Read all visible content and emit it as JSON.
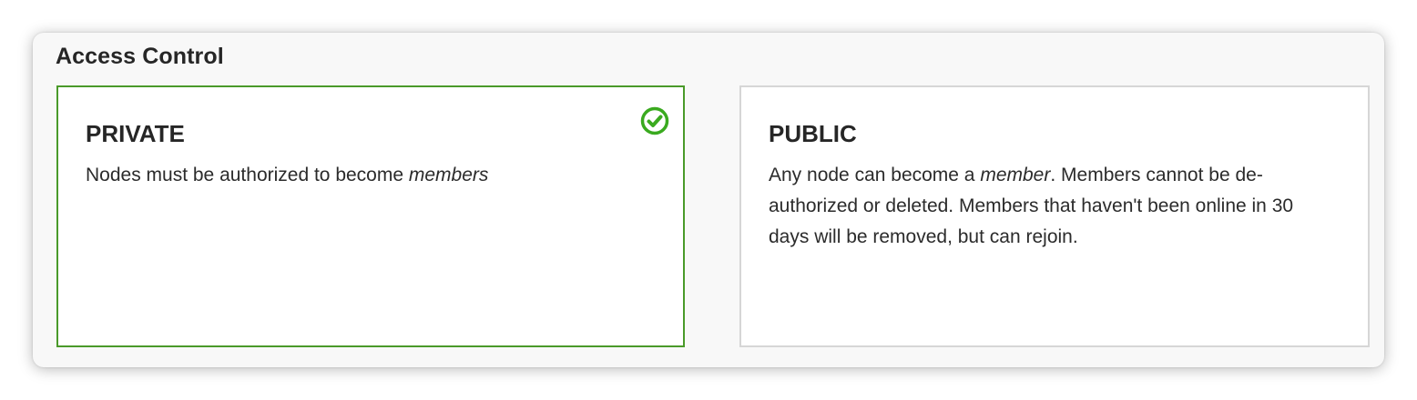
{
  "section": {
    "title": "Access Control"
  },
  "options": {
    "private": {
      "title": "PRIVATE",
      "desc_before": "Nodes must be authorized to become ",
      "desc_emphasis": "members",
      "desc_after": "",
      "selected": true,
      "selected_icon": "check-circle-icon"
    },
    "public": {
      "title": "PUBLIC",
      "desc_before": "Any node can become a ",
      "desc_emphasis": "member",
      "desc_after": ". Members cannot be de-authorized or deleted. Members that haven't been online in 30 days will be removed, but can rejoin.",
      "selected": false
    }
  },
  "colors": {
    "selected_border": "#4a9a2a",
    "check_icon": "#3aaa1f",
    "unselected_border": "#d6d6d6",
    "panel_background": "#f8f8f8"
  }
}
